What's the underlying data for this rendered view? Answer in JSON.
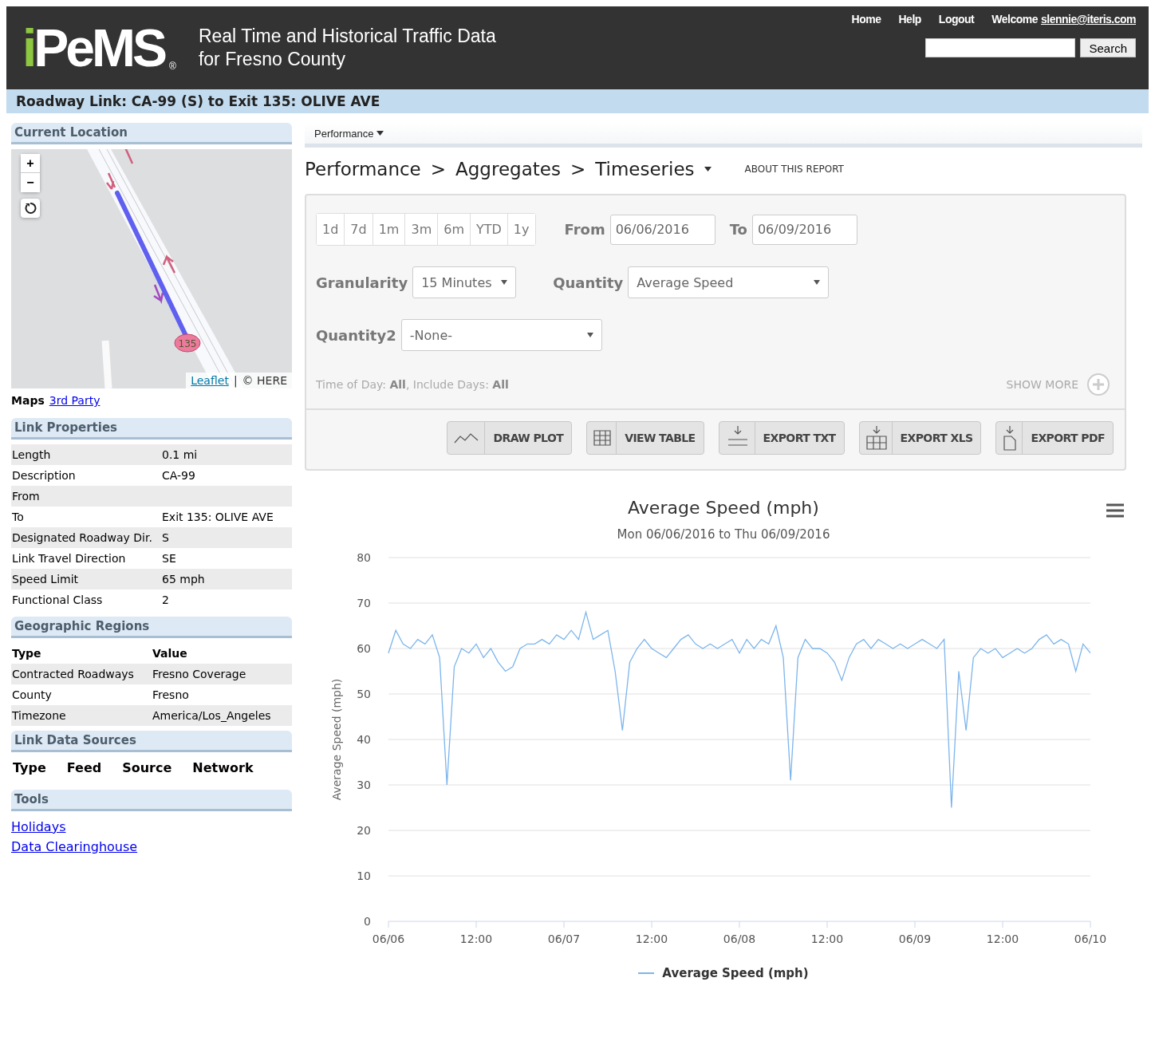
{
  "header": {
    "logo": "iPeMS",
    "logo_mark": "®",
    "title_lines": [
      "Real Time and Historical Traffic Data",
      "for Fresno County"
    ],
    "nav": [
      "Home",
      "Help",
      "Logout"
    ],
    "welcome": "Welcome",
    "user": "slennie@iteris.com",
    "search_button": "Search"
  },
  "page_title": "Roadway Link: CA-99 (S) to Exit 135: OLIVE AVE",
  "sidebar": {
    "location": {
      "heading": "Current Location",
      "zoom_in": "+",
      "zoom_out": "−",
      "marker_label": "135",
      "attribution_link": "Leaflet",
      "attribution_separator": "|",
      "attribution": "© HERE",
      "maps_label": "Maps",
      "maps_link": "3rd Party"
    },
    "link_properties": {
      "heading": "Link Properties",
      "rows": [
        {
          "label": "Length",
          "value": "0.1 mi"
        },
        {
          "label": "Description",
          "value": "CA-99"
        },
        {
          "label": "From"
        },
        {
          "label": "To",
          "value": "Exit 135: OLIVE AVE"
        },
        {
          "label": "Designated Roadway Dir.",
          "value": "S"
        },
        {
          "label": "Link Travel Direction",
          "value": "SE"
        },
        {
          "label": "Speed Limit",
          "value": "65 mph"
        },
        {
          "label": "Functional Class",
          "value": "2"
        }
      ]
    },
    "geographic_regions": {
      "heading": "Geographic Regions",
      "columns": [
        "Type",
        "Value"
      ],
      "rows": [
        [
          "Contracted Roadways",
          "Fresno Coverage"
        ],
        [
          "County",
          "Fresno"
        ],
        [
          "Timezone",
          "America/Los_Angeles"
        ]
      ]
    },
    "link_data_sources": {
      "heading": "Link Data Sources",
      "columns": [
        "Type",
        "Feed",
        "Source",
        "Network"
      ]
    },
    "tools": {
      "heading": "Tools",
      "links": [
        "Holidays",
        "Data Clearinghouse"
      ]
    }
  },
  "main": {
    "menu": "Performance",
    "breadcrumb": [
      "Performance",
      ">",
      "Aggregates",
      ">",
      "Timeseries"
    ],
    "about": "ABOUT THIS REPORT",
    "form": {
      "ranges": [
        "1d",
        "7d",
        "1m",
        "3m",
        "6m",
        "YTD",
        "1y"
      ],
      "from_label": "From",
      "from_value": "06/06/2016",
      "to_label": "To",
      "to_value": "06/09/2016",
      "granularity_label": "Granularity",
      "granularity_value": "15 Minutes",
      "quantity_label": "Quantity",
      "quantity_value": "Average Speed",
      "quantity2_label": "Quantity2",
      "quantity2_value": "-None-",
      "summary": "Time of Day: **All**,  Include Days: **All**",
      "show_more": "SHOW MORE",
      "actions": [
        {
          "label": "DRAW PLOT",
          "kind": "plot"
        },
        {
          "label": "VIEW TABLE",
          "kind": "table"
        },
        {
          "label": "EXPORT TXT",
          "kind": "txt"
        },
        {
          "label": "EXPORT XLS",
          "kind": "xls"
        },
        {
          "label": "EXPORT PDF",
          "kind": "pdf"
        }
      ]
    },
    "chart": {
      "subtitle": "Mon 06/06/2016 to Thu 06/09/2016",
      "chart_data": {
        "type": "line",
        "title": "Average Speed (mph)",
        "ylabel": "Average Speed (mph)",
        "categories": [
          "06/06",
          null,
          null,
          null,
          null,
          null,
          null,
          null,
          null,
          null,
          null,
          null,
          "12:00",
          null,
          null,
          null,
          null,
          null,
          null,
          null,
          null,
          null,
          null,
          null,
          "06/07",
          null,
          null,
          null,
          null,
          null,
          null,
          null,
          null,
          null,
          null,
          null,
          "12:00",
          null,
          null,
          null,
          null,
          null,
          null,
          null,
          null,
          null,
          null,
          null,
          "06/08",
          null,
          null,
          null,
          null,
          null,
          null,
          null,
          null,
          null,
          null,
          null,
          "12:00",
          null,
          null,
          null,
          null,
          null,
          null,
          null,
          null,
          null,
          null,
          null,
          "06/09",
          null,
          null,
          null,
          null,
          null,
          null,
          null,
          null,
          null,
          null,
          null,
          "12:00",
          null,
          null,
          null,
          null,
          null,
          null,
          null,
          null,
          null,
          null,
          null,
          "06/10"
        ],
        "series": [
          {
            "name": "Average Speed (mph)",
            "color": "#7cb5ec",
            "values": [
              59,
              64,
              61,
              60,
              62,
              61,
              63,
              58,
              30,
              56,
              60,
              59,
              61,
              58,
              60,
              57,
              55,
              56,
              60,
              61,
              61,
              62,
              61,
              63,
              62,
              64,
              62,
              68,
              62,
              63,
              64,
              55,
              42,
              57,
              60,
              62,
              60,
              59,
              58,
              60,
              62,
              63,
              61,
              60,
              61,
              60,
              61,
              62,
              59,
              62,
              60,
              62,
              61,
              65,
              58,
              31,
              58,
              62,
              60,
              60,
              59,
              57,
              53,
              58,
              61,
              62,
              60,
              62,
              61,
              60,
              61,
              60,
              61,
              62,
              61,
              60,
              62,
              25,
              55,
              42,
              58,
              60,
              59,
              60,
              58,
              59,
              60,
              59,
              60,
              62,
              63,
              61,
              62,
              61,
              55,
              61,
              59
            ]
          }
        ],
        "grid": true,
        "ylim": [
          0,
          80
        ],
        "yticks": [
          0,
          10,
          20,
          30,
          40,
          50,
          60,
          70,
          80
        ]
      }
    }
  }
}
